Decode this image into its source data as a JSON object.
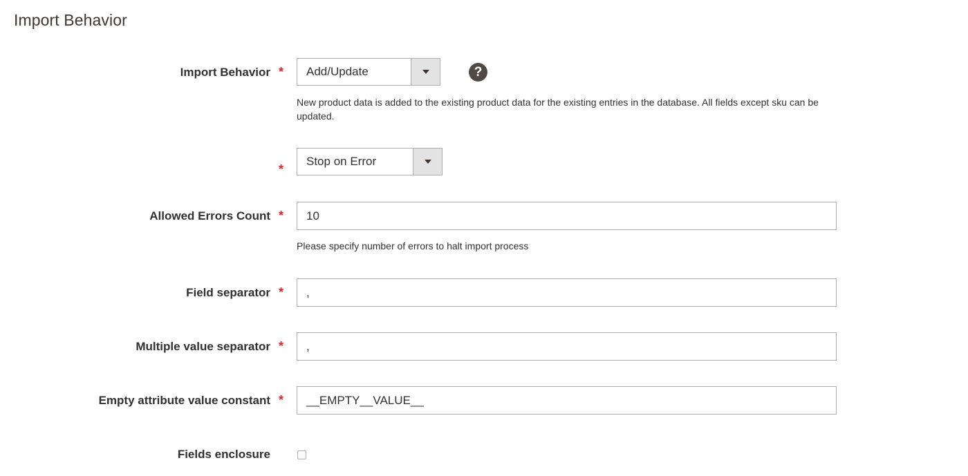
{
  "section": {
    "title": "Import Behavior"
  },
  "fields": {
    "import_behavior": {
      "label": "Import Behavior",
      "required_mark": "*",
      "value": "Add/Update",
      "help_icon": "question-circle-icon",
      "note": "New product data is added to the existing product data for the existing entries in the database. All fields except sku can be updated."
    },
    "validation_strategy": {
      "required_mark": "*",
      "value": "Stop on Error"
    },
    "allowed_errors_count": {
      "label": "Allowed Errors Count",
      "required_mark": "*",
      "value": "10",
      "note": "Please specify number of errors to halt import process"
    },
    "field_separator": {
      "label": "Field separator",
      "required_mark": "*",
      "value": ","
    },
    "multiple_value_separator": {
      "label": "Multiple value separator",
      "required_mark": "*",
      "value": ","
    },
    "empty_attribute_value_constant": {
      "label": "Empty attribute value constant",
      "required_mark": "*",
      "value": "__EMPTY__VALUE__"
    },
    "fields_enclosure": {
      "label": "Fields enclosure",
      "checked": false
    }
  },
  "colors": {
    "required": "#e22626",
    "title": "#41362f",
    "border": "#adadad",
    "help_bg": "#514943"
  }
}
